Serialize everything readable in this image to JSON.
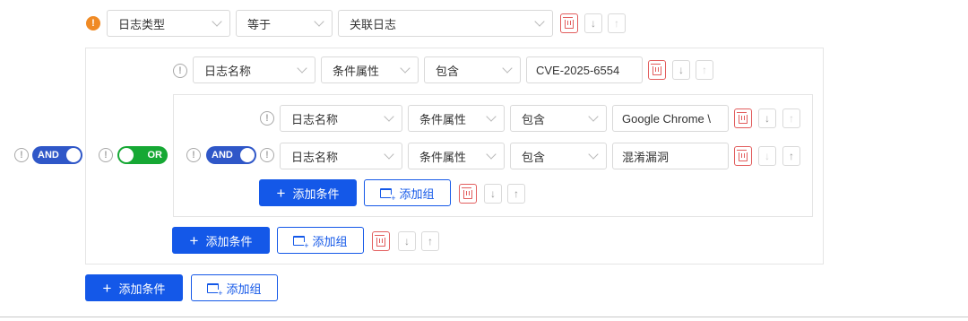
{
  "top_row": {
    "field": "日志类型",
    "operator": "等于",
    "value": "关联日志"
  },
  "outer_group": {
    "logic": "AND",
    "row1": {
      "field": "日志名称",
      "attribute": "条件属性",
      "operator": "包含",
      "value": "CVE-2025-6554"
    },
    "or_group": {
      "logic": "OR",
      "inner_group": {
        "logic": "AND",
        "row1": {
          "field": "日志名称",
          "attribute": "条件属性",
          "operator": "包含",
          "value": "Google Chrome \\"
        },
        "row2": {
          "field": "日志名称",
          "attribute": "条件属性",
          "operator": "包含",
          "value": "混淆漏洞"
        }
      }
    }
  },
  "buttons": {
    "add_condition": "添加条件",
    "add_group": "添加组"
  },
  "icons": {
    "delete": "trash-icon",
    "move_down": "arrow-down-icon",
    "move_up": "arrow-up-icon",
    "info": "info-icon",
    "warning": "warning-icon"
  },
  "glyphs": {
    "plus": "+",
    "down": "↓",
    "up": "↑",
    "info": "!",
    "warn": "!"
  },
  "colors": {
    "primary": "#1458e8",
    "and_toggle": "#2f57c8",
    "or_toggle": "#16a834",
    "delete": "#e25d5d",
    "warning": "#f08a24"
  }
}
